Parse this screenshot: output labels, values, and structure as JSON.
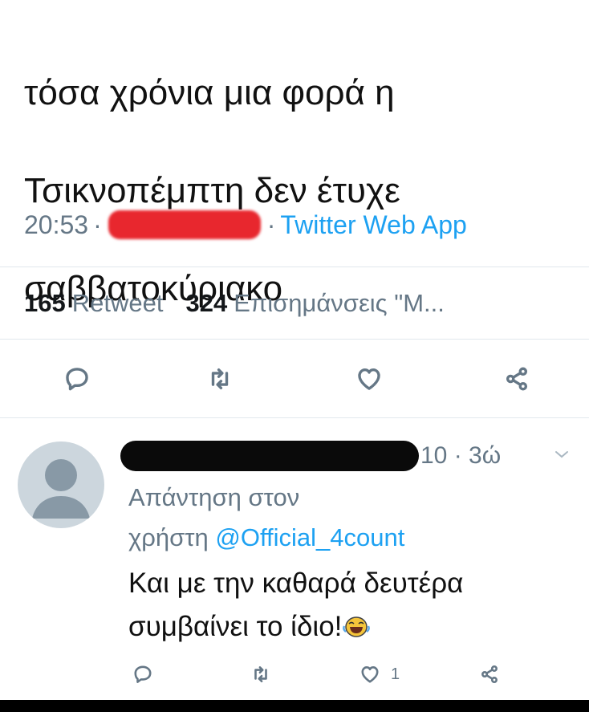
{
  "tweet": {
    "text_line1": "τόσα χρόνια μια φορά η",
    "text_line2": "Τσικνοπέμπτη δεν έτυχε",
    "text_line3": "σαββατοκύριακο",
    "time": "20:53",
    "separator": "·",
    "source": "Twitter Web App",
    "retweets_count": "165",
    "retweets_label": "Retweet",
    "likes_count": "324",
    "likes_label": "Επισημάνσεις \"Μ..."
  },
  "reply": {
    "time_suffix": "10 · 3ώ",
    "reply_to_line1": "Απάντηση στον",
    "reply_to_line2_prefix": "χρήστη ",
    "reply_to_mention": "@Official_4count",
    "text_line1": "Και με την καθαρά δευτέρα",
    "text_line2": "συμβαίνει το ίδιο!",
    "like_count": "1"
  },
  "colors": {
    "text": "#111111",
    "secondary": "#657786",
    "link": "#1da1f2",
    "redaction_red": "#e8272e",
    "redaction_black": "#0a0a0a"
  },
  "icons": {
    "reply": "reply-icon",
    "retweet": "retweet-icon",
    "like": "heart-icon",
    "share": "share-icon",
    "avatar": "default-avatar-icon",
    "emoji": "laughing-emoji-icon",
    "more": "chevron-down-icon"
  }
}
